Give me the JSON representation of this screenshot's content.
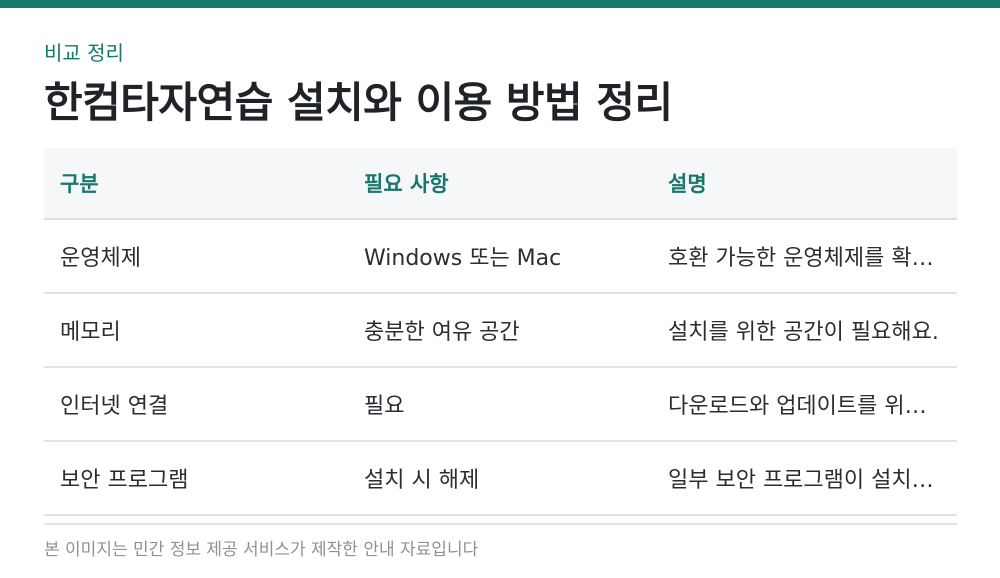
{
  "accent_color": "#16776b",
  "eyebrow": "비교 정리",
  "title": "한컴타자연습 설치와 이용 방법 정리",
  "table": {
    "headers": [
      "구분",
      "필요 사항",
      "설명"
    ],
    "rows": [
      [
        "운영체제",
        "Windows 또는 Mac",
        "호환 가능한 운영체제를 확…"
      ],
      [
        "메모리",
        "충분한 여유 공간",
        "설치를 위한 공간이 필요해요."
      ],
      [
        "인터넷 연결",
        "필요",
        "다운로드와 업데이트를 위…"
      ],
      [
        "보안 프로그램",
        "설치 시 해제",
        "일부 보안 프로그램이 설치…"
      ]
    ]
  },
  "footnote": "본 이미지는 민간 정보 제공 서비스가 제작한 안내 자료입니다"
}
